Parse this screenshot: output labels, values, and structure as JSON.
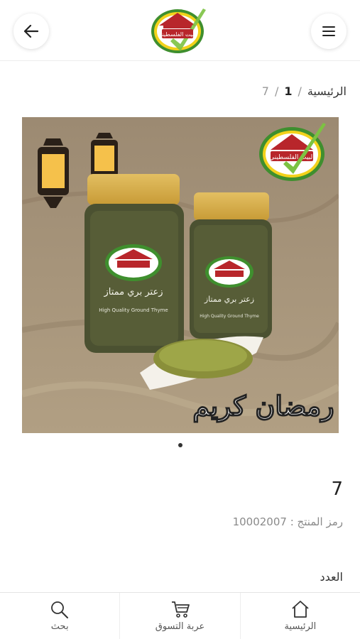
{
  "header": {
    "back_icon": "arrow-left-icon",
    "menu_icon": "hamburger-menu-icon",
    "logo_text": "البيت الفلسطيني"
  },
  "breadcrumb": {
    "home": "الرئيسية",
    "separator": "/",
    "category": "1",
    "current": "7"
  },
  "product": {
    "title": "7",
    "sku_label": "رمز المنتج :",
    "sku_value": "10002007",
    "quantity_label": "العدد",
    "image": {
      "jar_text_ar": "زعتر بري ممتاز",
      "jar_text_en": "High Quality Ground Thyme",
      "greeting": "رمضان كريم"
    },
    "carousel_dots": 1
  },
  "bottom_nav": {
    "items": [
      {
        "label": "الرئيسية",
        "icon": "home-icon"
      },
      {
        "label": "عربة التسوق",
        "icon": "cart-icon"
      },
      {
        "label": "بحث",
        "icon": "search-icon"
      }
    ]
  },
  "colors": {
    "logo_red": "#b8262b",
    "logo_green": "#3f8f2e",
    "logo_yellow": "#f3d21b"
  }
}
